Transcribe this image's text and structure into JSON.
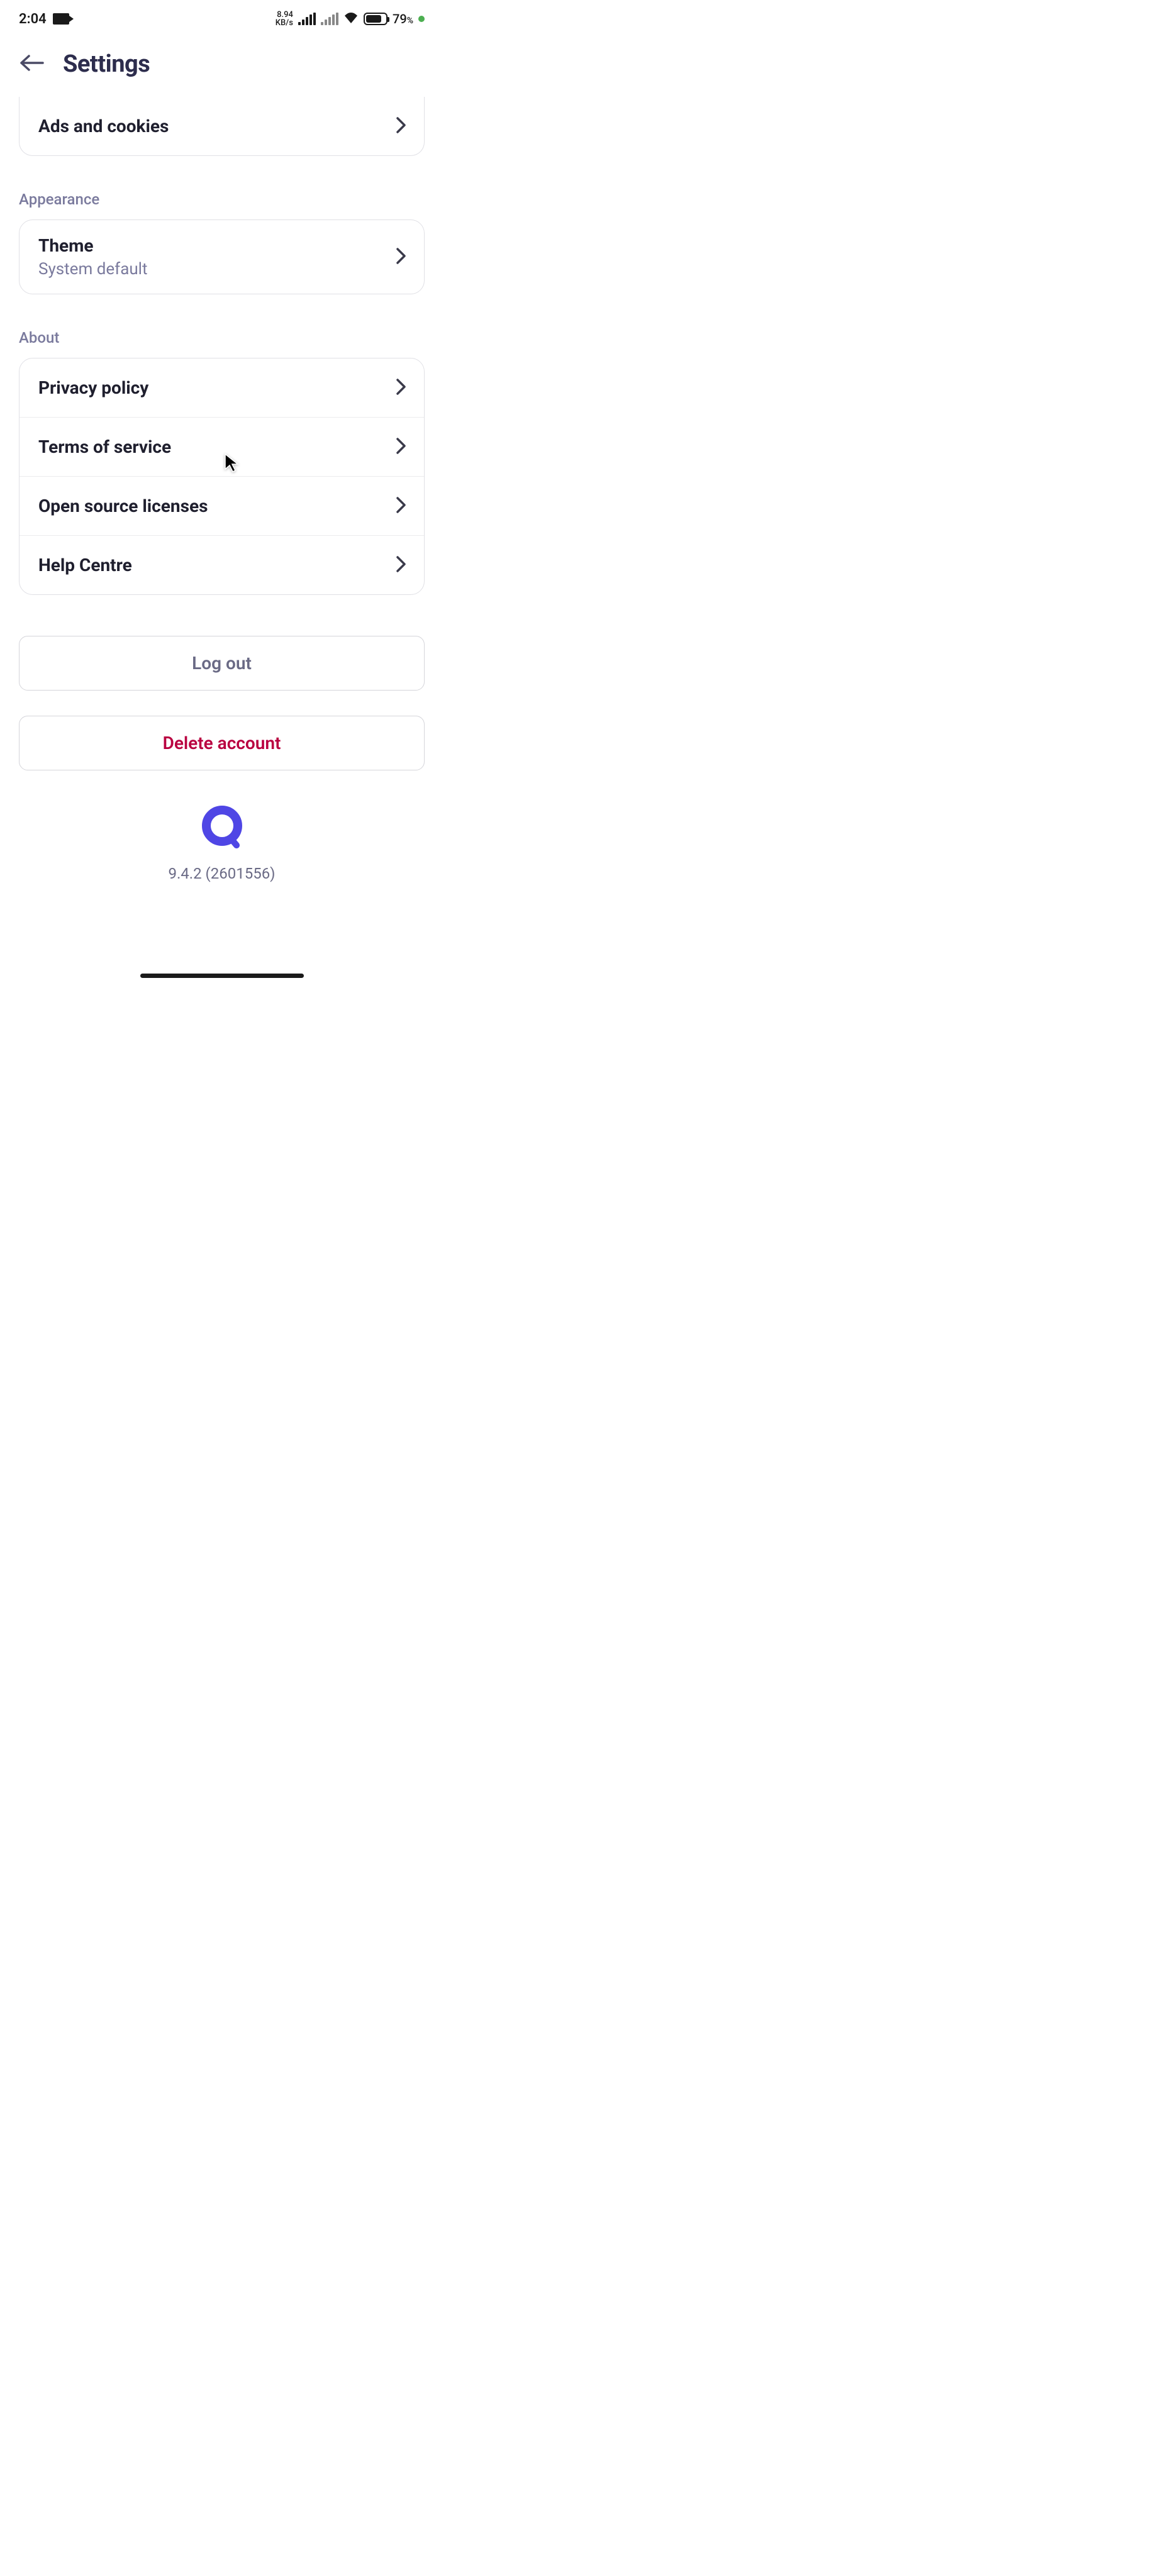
{
  "status_bar": {
    "time": "2:04",
    "kb_rate": "8.94",
    "kb_unit": "KB/s",
    "battery_percent": "79",
    "battery_unit": "%"
  },
  "header": {
    "title": "Settings"
  },
  "top_item": {
    "label": "Ads and cookies"
  },
  "sections": {
    "appearance": {
      "header": "Appearance",
      "theme": {
        "label": "Theme",
        "value": "System default"
      }
    },
    "about": {
      "header": "About",
      "items": {
        "privacy": "Privacy policy",
        "terms": "Terms of service",
        "licenses": "Open source licenses",
        "help": "Help Centre"
      }
    }
  },
  "actions": {
    "logout": "Log out",
    "delete": "Delete account"
  },
  "footer": {
    "version": "9.4.2 (2601556)"
  }
}
